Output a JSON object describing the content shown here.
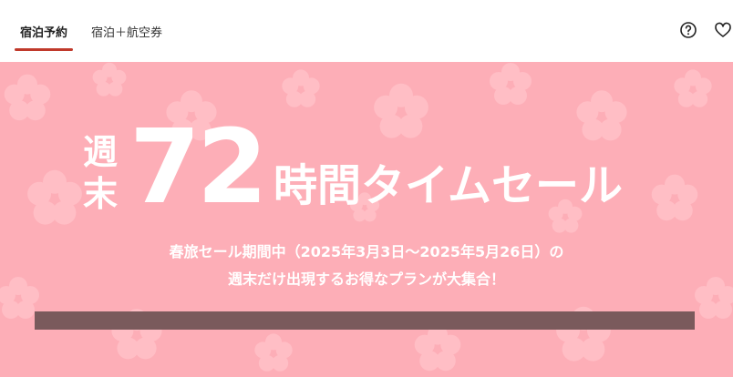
{
  "tabs": [
    {
      "label": "宿泊予約",
      "active": true
    },
    {
      "label": "宿泊＋航空券",
      "active": false
    }
  ],
  "icons": {
    "help": "help-circle-icon",
    "favorite": "heart-icon"
  },
  "banner": {
    "weekend_top": "週",
    "weekend_bottom": "末",
    "hours": "72",
    "headline": "時間タイムセール",
    "sub_line1": "春旅セール期間中（2025年3月3日～2025年5月26日）の",
    "sub_line2": "週末だけ出現するお得なプランが大集合！",
    "bg_color": "#fdaeb7",
    "bar_color": "#7a5a5c"
  }
}
